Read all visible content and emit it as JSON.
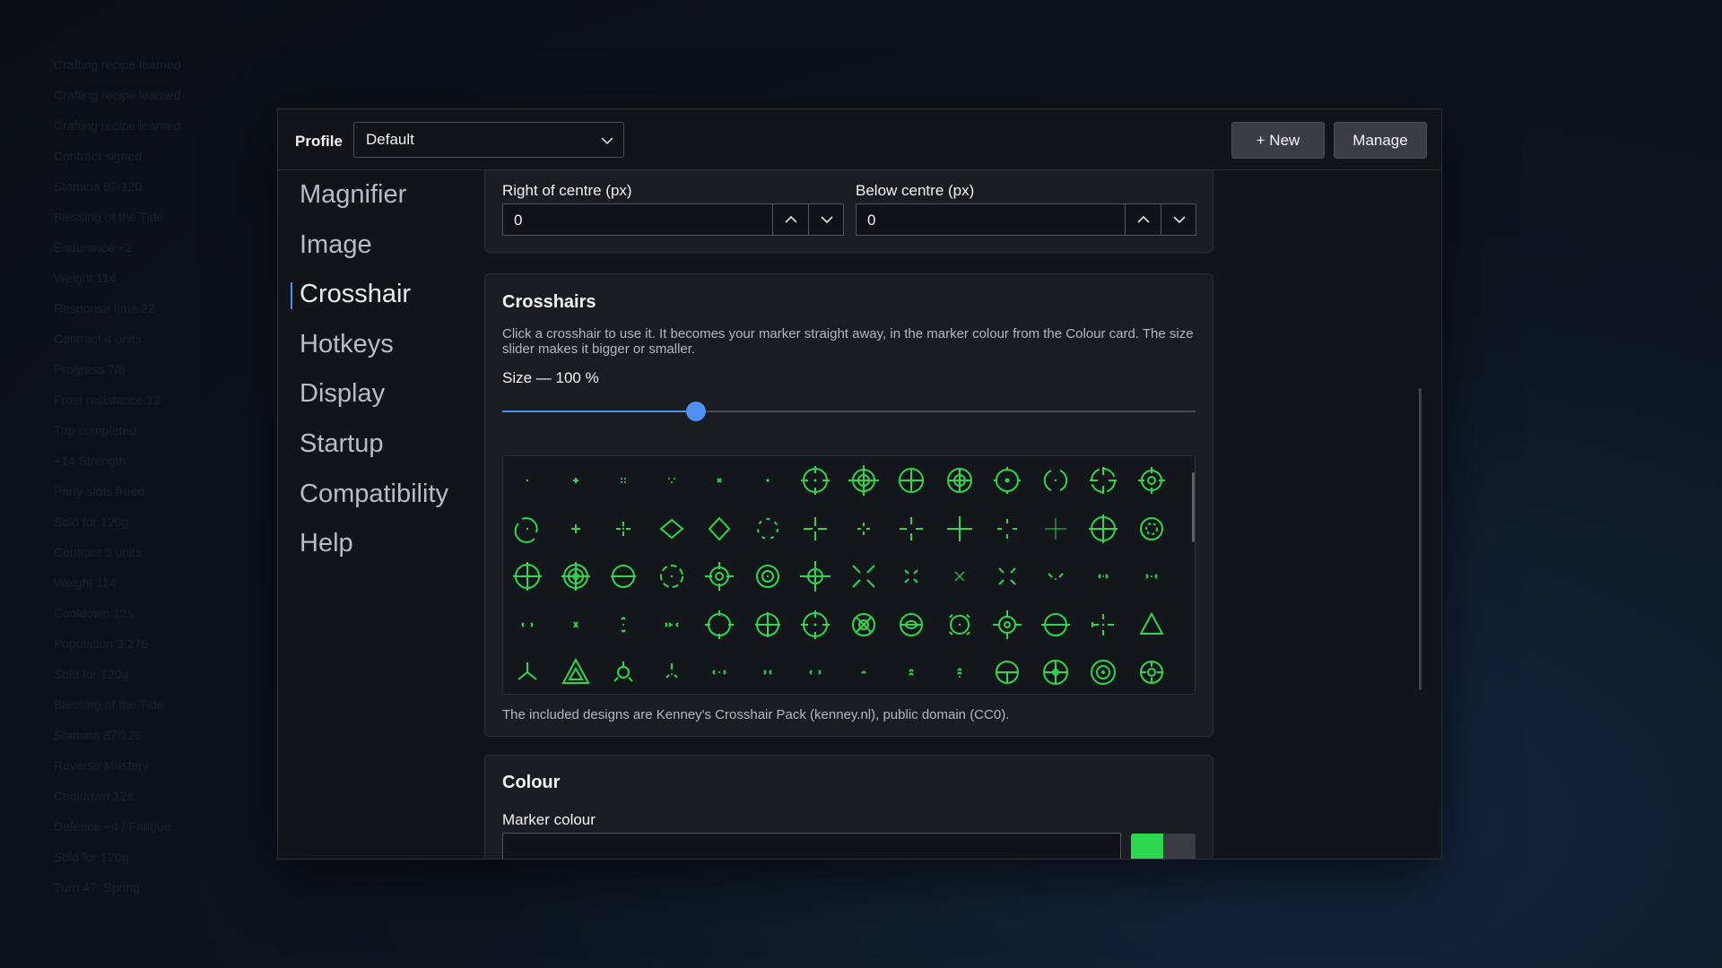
{
  "background_log": [
    "Crafting recipe learned",
    "Crafting recipe learned",
    "Crafting recipe learned",
    "Contract signed",
    "Stamina 87/120",
    "Blessing of the Tide",
    "Endurance +2",
    "Weight 114",
    "Response time 22",
    "Contract 4 units",
    "Progress 7/8",
    "Frost resistance 12",
    "Trip completed",
    "+14 Strength",
    "Party slots freed",
    "Sold for 120g",
    "Contract 3 units",
    "Weight 114",
    "Cooldown 12s",
    "Population 3,276",
    "Sold for 120g",
    "Blessing of the Tide",
    "Stamina 87/120",
    "Reverse Mastery",
    "Cooldown 12s",
    "Defence +4 / Fatigue",
    "Sold for 120g",
    "Turn 47: Spring"
  ],
  "header": {
    "profile_label": "Profile",
    "profile_value": "Default",
    "new_button": "+ New",
    "manage_button": "Manage"
  },
  "sidebar": {
    "items": [
      "Magnifier",
      "Image",
      "Crosshair",
      "Hotkeys",
      "Display",
      "Startup",
      "Compatibility",
      "Help"
    ],
    "active": "Crosshair"
  },
  "offset": {
    "right_label": "Right of centre (px)",
    "right_value": "0",
    "below_label": "Below centre (px)",
    "below_value": "0"
  },
  "crosshairs": {
    "title": "Crosshairs",
    "description": "Click a crosshair to use it. It becomes your marker straight away, in the marker colour from the Colour card. The size slider makes it bigger or smaller.",
    "size_label": "Size — 100 %",
    "size_fraction": 0.28,
    "credit": "The included designs are Kenney's Crosshair Pack (kenney.nl), public domain (CC0)."
  },
  "colour": {
    "title": "Colour",
    "marker_label": "Marker colour"
  },
  "colors": {
    "accent": "#4d8ff3",
    "marker": "#2ed84c"
  }
}
